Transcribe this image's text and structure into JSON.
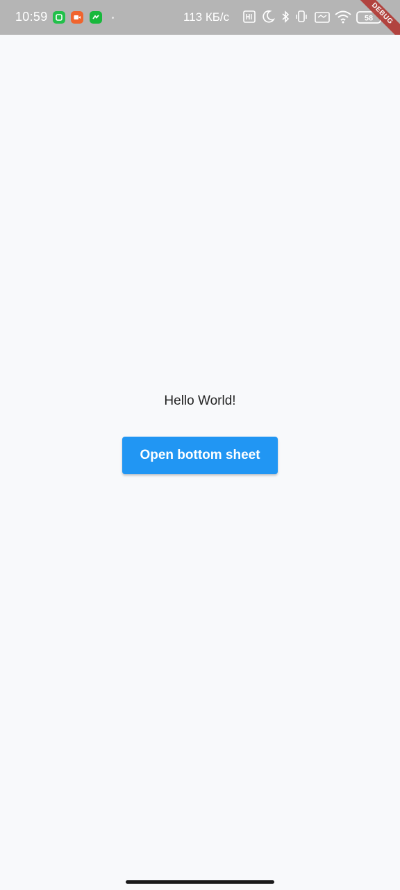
{
  "status_bar": {
    "time": "10:59",
    "network_speed": "113 КБ/с",
    "notification_icons": [
      "chat-app-icon",
      "video-app-icon",
      "messenger-app-icon"
    ],
    "system_icons": [
      "hd-icon",
      "moon-icon",
      "bluetooth-icon",
      "vibrate-icon",
      "sim-icon",
      "wifi-icon",
      "battery-icon"
    ],
    "battery_level": "58",
    "debug_banner": "DEBUG",
    "colors": {
      "background": "#b5b5b5",
      "banner": "#b13a35"
    }
  },
  "main": {
    "hello_text": "Hello World!",
    "open_sheet_button_label": "Open bottom sheet",
    "button_color": "#2196f3",
    "background": "#f8f9fb"
  }
}
